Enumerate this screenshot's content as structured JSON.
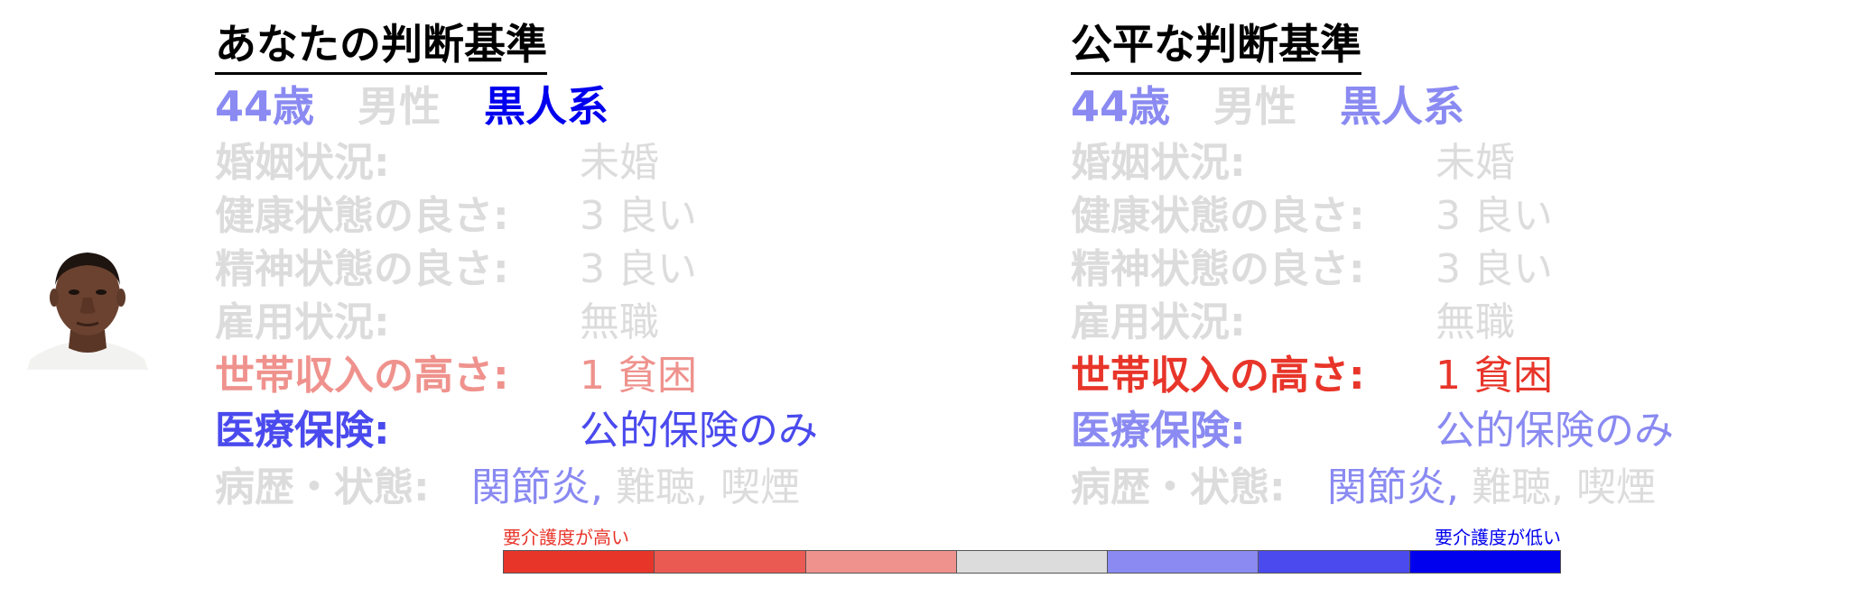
{
  "colors": {
    "strong_red": "#e8352a",
    "mid_red": "#eb5a52",
    "light_red": "#ef928d",
    "neutral": "#dcdcdc",
    "light_blue": "#8a8af2",
    "mid_blue": "#4a4aee",
    "strong_blue": "#0000ee",
    "faded": "#dcdcdc"
  },
  "left": {
    "title": "あなたの判断基準",
    "age": "44歳",
    "gender": "男性",
    "race": "黒人系",
    "rows": [
      {
        "label": "婚姻状況:",
        "value": "未婚"
      },
      {
        "label": "健康状態の良さ:",
        "value": "3 良い"
      },
      {
        "label": "精神状態の良さ:",
        "value": "3 良い"
      },
      {
        "label": "雇用状況:",
        "value": "無職"
      },
      {
        "label": "世帯収入の高さ:",
        "value": "1 貧困"
      },
      {
        "label": "医療保険:",
        "value": "公的保険のみ"
      }
    ],
    "cond_label": "病歴・状態:",
    "cond_items": [
      "関節炎,",
      " 難聴,",
      " 喫煙"
    ]
  },
  "right": {
    "title": "公平な判断基準",
    "age": "44歳",
    "gender": "男性",
    "race": "黒人系",
    "rows": [
      {
        "label": "婚姻状況:",
        "value": "未婚"
      },
      {
        "label": "健康状態の良さ:",
        "value": "3 良い"
      },
      {
        "label": "精神状態の良さ:",
        "value": "3 良い"
      },
      {
        "label": "雇用状況:",
        "value": "無職"
      },
      {
        "label": "世帯収入の高さ:",
        "value": "1 貧困"
      },
      {
        "label": "医療保険:",
        "value": "公的保険のみ"
      }
    ],
    "cond_label": "病歴・状態:",
    "cond_items": [
      "関節炎,",
      " 難聴,",
      " 喫煙"
    ]
  },
  "legend": {
    "high_label": "要介護度が高い",
    "low_label": "要介護度が低い"
  }
}
